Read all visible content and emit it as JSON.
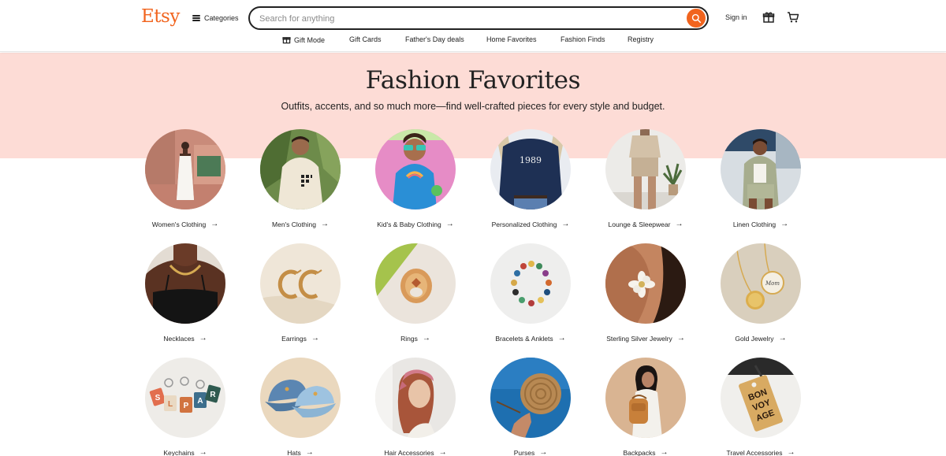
{
  "header": {
    "logo": "Etsy",
    "categories_label": "Categories",
    "search_placeholder": "Search for anything",
    "signin_label": "Sign in"
  },
  "subnav": [
    {
      "label": "Gift Mode",
      "icon": "gift-icon"
    },
    {
      "label": "Gift Cards"
    },
    {
      "label": "Father's Day deals"
    },
    {
      "label": "Home Favorites"
    },
    {
      "label": "Fashion Finds"
    },
    {
      "label": "Registry"
    }
  ],
  "hero": {
    "title": "Fashion Favorites",
    "subtitle": "Outfits, accents, and so much more—find well-crafted pieces for every style and budget."
  },
  "categories": [
    {
      "label": "Women's Clothing"
    },
    {
      "label": "Men's Clothing"
    },
    {
      "label": "Kid's & Baby Clothing"
    },
    {
      "label": "Personalized Clothing"
    },
    {
      "label": "Lounge & Sleepwear"
    },
    {
      "label": "Linen Clothing"
    },
    {
      "label": "Necklaces"
    },
    {
      "label": "Earrings"
    },
    {
      "label": "Rings"
    },
    {
      "label": "Bracelets & Anklets"
    },
    {
      "label": "Sterling Silver Jewelry"
    },
    {
      "label": "Gold Jewelry"
    },
    {
      "label": "Keychains"
    },
    {
      "label": "Hats"
    },
    {
      "label": "Hair Accessories"
    },
    {
      "label": "Purses"
    },
    {
      "label": "Backpacks"
    },
    {
      "label": "Travel Accessories"
    }
  ],
  "image_text": {
    "shirt_print": "1989",
    "keychain_letters": [
      "S",
      "L",
      "P",
      "A",
      "R"
    ],
    "tag_text": [
      "BON",
      "VOY",
      "AGE"
    ],
    "pendant_text": "Mom"
  },
  "colors": {
    "brand": "#f1641e",
    "hero_band": "#fddcd6",
    "text": "#222222"
  }
}
